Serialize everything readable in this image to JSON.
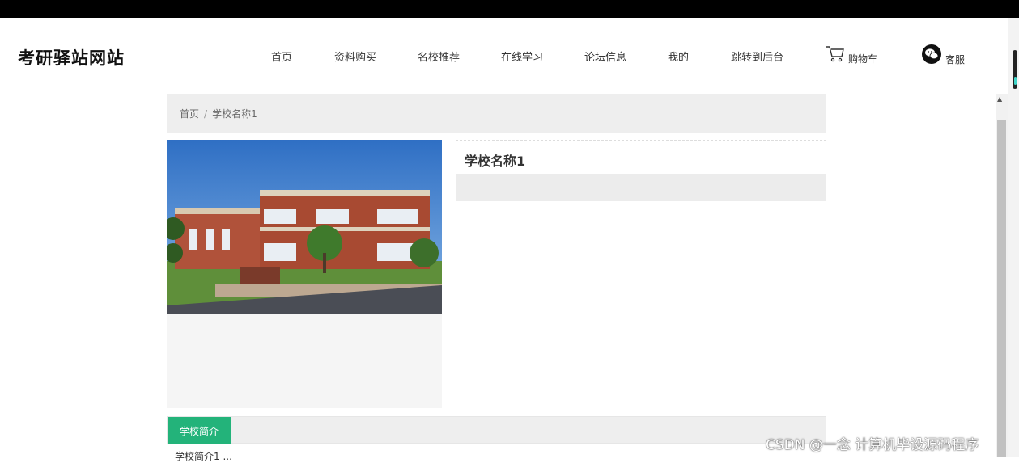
{
  "site": {
    "logo": "考研驿站网站"
  },
  "nav": {
    "items": [
      "首页",
      "资料购买",
      "名校推荐",
      "在线学习",
      "论坛信息",
      "我的",
      "跳转到后台"
    ],
    "cart": "购物车",
    "service": "客服"
  },
  "breadcrumb": {
    "home": "首页",
    "separator": "/",
    "current": "学校名称1"
  },
  "school": {
    "name": "学校名称1"
  },
  "tabs": {
    "active": "学校简介"
  },
  "intro": {
    "text": "学校简介1 ..."
  },
  "watermark": "CSDN @一念 计算机毕设源码程序",
  "colors": {
    "accent": "#23b37a",
    "topbar": "#000000",
    "panel": "#eeeeee"
  },
  "icons": [
    "cart-icon",
    "wechat-icon",
    "scroll-up-icon"
  ]
}
